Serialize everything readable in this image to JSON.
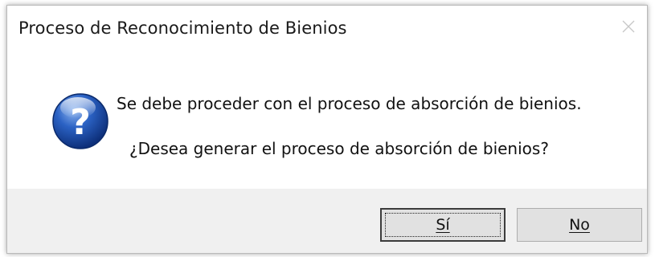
{
  "dialog": {
    "title": "Proceso de Reconocimiento de Bienios",
    "close_icon": "close-icon",
    "icon": "question-icon",
    "message_line1": "Se debe proceder con el proceso de absorción de bienios.",
    "message_line2": "¿Desea generar el proceso de absorción de bienios?",
    "buttons": {
      "yes_label": "Sí",
      "no_label": "No"
    },
    "colors": {
      "icon_blue": "#1f4fa8",
      "footer_bg": "#f0f0f0",
      "button_bg": "#e1e1e1"
    }
  }
}
